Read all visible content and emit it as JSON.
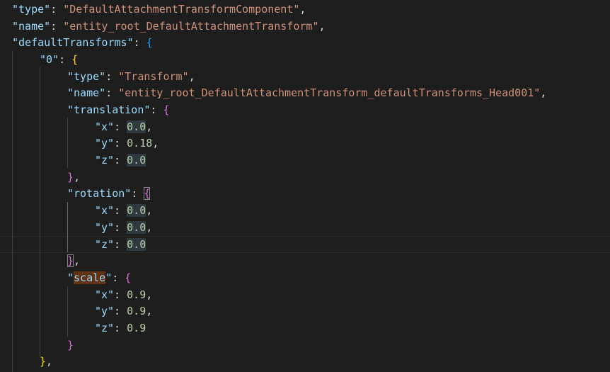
{
  "lines": [
    {
      "indent": "",
      "key": "\"type\"",
      "value": "\"DefaultAttachmentTransformComponent\"",
      "suffix": ","
    },
    {
      "indent": "",
      "key": "\"name\"",
      "value": "\"entity_root_DefaultAttachmentTransform\"",
      "suffix": ","
    },
    {
      "indent": "",
      "key": "\"defaultTransforms\"",
      "open": "{"
    },
    {
      "indent": "    ",
      "key": "\"0\"",
      "open": "{"
    },
    {
      "indent": "        ",
      "key": "\"type\"",
      "value": "\"Transform\"",
      "suffix": ","
    },
    {
      "indent": "        ",
      "key": "\"name\"",
      "value": "\"entity_root_DefaultAttachmentTransform_defaultTransforms_Head001\"",
      "suffix": ","
    },
    {
      "indent": "        ",
      "key": "\"translation\"",
      "open": "{"
    },
    {
      "indent": "            ",
      "key": "\"x\"",
      "value": "0.0",
      "suffix": ","
    },
    {
      "indent": "            ",
      "key": "\"y\"",
      "value": "0.18",
      "suffix": ","
    },
    {
      "indent": "            ",
      "key": "\"z\"",
      "value": "0.0",
      "suffix": ""
    },
    {
      "indent": "        ",
      "close": "}",
      "suffix": ","
    },
    {
      "indent": "        ",
      "key": "\"rotation\"",
      "open": "{"
    },
    {
      "indent": "            ",
      "key": "\"x\"",
      "value": "0.0",
      "suffix": ","
    },
    {
      "indent": "            ",
      "key": "\"y\"",
      "value": "0.0",
      "suffix": ","
    },
    {
      "indent": "            ",
      "key": "\"z\"",
      "value": "0.0",
      "suffix": ""
    },
    {
      "indent": "        ",
      "close": "}",
      "suffix": ","
    },
    {
      "indent": "        ",
      "key_open_quote": "\"",
      "key_word": "scale",
      "key_close_quote": "\"",
      "open": "{"
    },
    {
      "indent": "            ",
      "key": "\"x\"",
      "value": "0.9",
      "suffix": ","
    },
    {
      "indent": "            ",
      "key": "\"y\"",
      "value": "0.9",
      "suffix": ","
    },
    {
      "indent": "            ",
      "key": "\"z\"",
      "value": "0.9",
      "suffix": ""
    },
    {
      "indent": "        ",
      "close": "}",
      "suffix": ""
    },
    {
      "indent": "    ",
      "close": "}",
      "suffix": ","
    }
  ],
  "colors": {
    "background": "#1e1e1e",
    "key": "#9cdcfe",
    "string": "#ce9178",
    "number": "#b5cea8",
    "bracket_level1": "#ffd700",
    "bracket_level2": "#da70d6",
    "bracket_level3": "#179fff"
  }
}
